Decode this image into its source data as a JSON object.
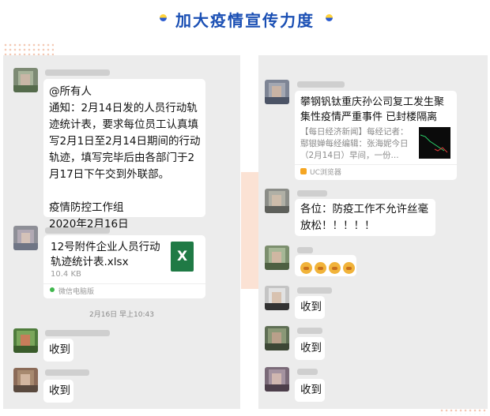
{
  "header": {
    "title": "加大疫情宣传力度"
  },
  "left_chat": {
    "messages": [
      {
        "text": "@所有人\n通知：2月14日发的人员行动轨迹统计表，要求每位员工认真填写2月1日至2月14日期间的行动轨迹，填写完毕后由各部门于2月17日下午交到外联部。\n\n疫情防控工作组\n2020年2月16日"
      },
      {
        "file_name": "12号附件企业人员行动轨迹统计表.xlsx",
        "file_size": "10.4 KB",
        "file_source": "微信电脑版",
        "file_icon": "excel-icon",
        "file_icon_letter": "X"
      },
      {
        "text": "收到"
      },
      {
        "text": "收到"
      }
    ],
    "timestamp": "2月16日 早上10:43"
  },
  "right_chat": {
    "link_card": {
      "title": "攀钢钒钛重庆孙公司复工发生聚集性疫情严重事件 已封楼隔离",
      "desc": "【每日经济新闻】每经记者：鄢银婵每经编辑：张海妮今日（2月14日）早间，一份...",
      "source": "UC浏览器"
    },
    "messages": [
      {
        "text": "各位：防疫工作不允许丝毫放松！！！！！"
      },
      {
        "text": "收到"
      },
      {
        "text": "收到"
      },
      {
        "text": "收到"
      }
    ],
    "emoji_count": 4
  },
  "colors": {
    "title": "#1a4fb4",
    "excel": "#1f7a45",
    "panel": "#ececec"
  }
}
